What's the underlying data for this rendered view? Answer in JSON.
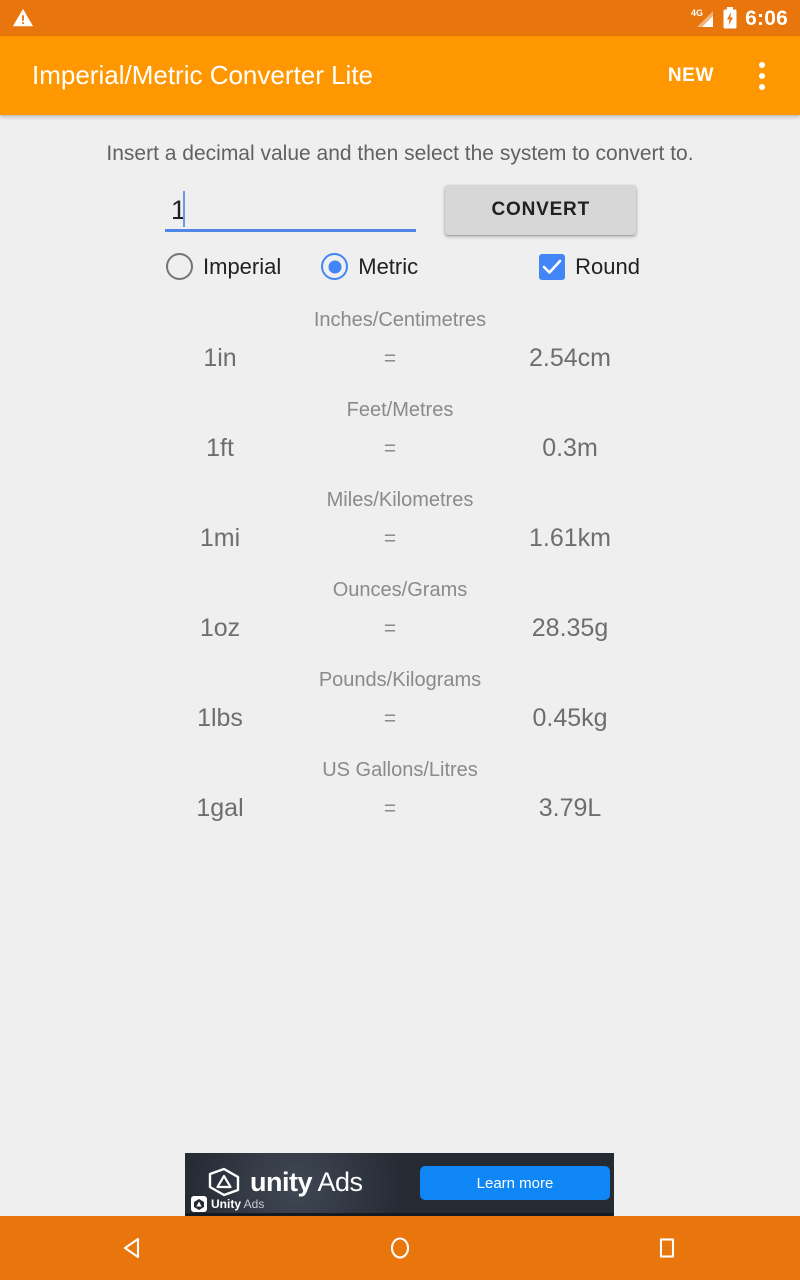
{
  "status_bar": {
    "warning_icon": "warning-triangle-icon",
    "network_label": "4G",
    "signal_icon": "signal-bars-icon",
    "battery_icon": "battery-charging-icon",
    "time": "6:06",
    "background_color": "#e8760c"
  },
  "app_bar": {
    "title": "Imperial/Metric Converter Lite",
    "new_label": "NEW",
    "overflow_icon": "overflow-menu-icon",
    "background_color": "#ff9800"
  },
  "main": {
    "instruction": "Insert a decimal value and then select the system to convert to.",
    "input": {
      "value": "1",
      "placeholder": ""
    },
    "convert_label": "CONVERT",
    "options": {
      "imperial_label": "Imperial",
      "imperial_selected": false,
      "metric_label": "Metric",
      "metric_selected": true,
      "round_label": "Round",
      "round_checked": true,
      "accent_color": "#4285f4"
    },
    "equals_symbol": "=",
    "conversions": [
      {
        "title": "Inches/Centimetres",
        "from": "1in",
        "to": "2.54cm"
      },
      {
        "title": "Feet/Metres",
        "from": "1ft",
        "to": "0.3m"
      },
      {
        "title": "Miles/Kilometres",
        "from": "1mi",
        "to": "1.61km"
      },
      {
        "title": "Ounces/Grams",
        "from": "1oz",
        "to": "28.35g"
      },
      {
        "title": "Pounds/Kilograms",
        "from": "1lbs",
        "to": "0.45kg"
      },
      {
        "title": "US Gallons/Litres",
        "from": "1gal",
        "to": "3.79L"
      }
    ]
  },
  "ad": {
    "logo_icon": "unity-logo-icon",
    "brand_bold": "unity",
    "brand_light": " Ads",
    "cta_label": "Learn more",
    "attribution_bold": "Unity",
    "attribution_light": "Ads",
    "cta_color": "#0e86f5"
  },
  "nav_bar": {
    "back_icon": "back-triangle-icon",
    "home_icon": "home-circle-icon",
    "recents_icon": "recents-square-icon",
    "background_color": "#e8760c"
  }
}
